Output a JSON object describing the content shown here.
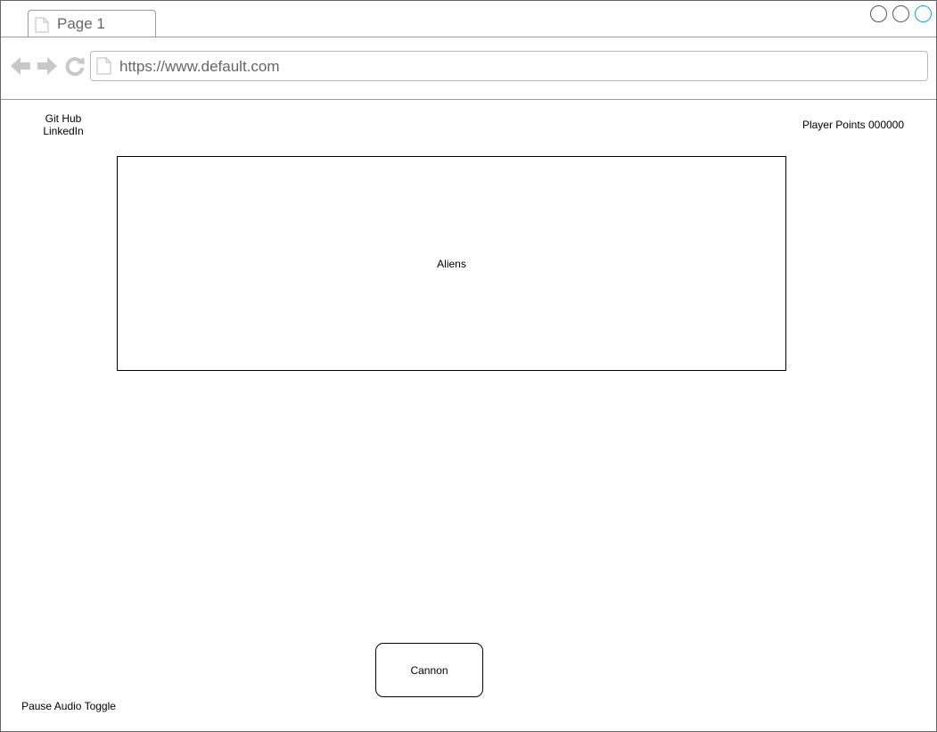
{
  "browser": {
    "tab": {
      "title": "Page 1",
      "icon": "page-icon"
    },
    "window_controls": [
      "minimize-icon",
      "maximize-icon",
      "close-icon"
    ],
    "nav": {
      "back_icon": "back-arrow-icon",
      "forward_icon": "forward-arrow-icon",
      "reload_icon": "reload-icon"
    },
    "address": {
      "url": "https://www.default.com",
      "icon": "page-icon"
    },
    "colors": {
      "close_accent": "#1b9bd1",
      "chrome_gray": "#c8c8c8"
    }
  },
  "page": {
    "links": [
      "Git Hub",
      "LinkedIn"
    ],
    "player_points": "Player Points 000000",
    "aliens_label": "Aliens",
    "cannon_label": "Cannon",
    "pause_audio_toggle": "Pause Audio Toggle"
  }
}
